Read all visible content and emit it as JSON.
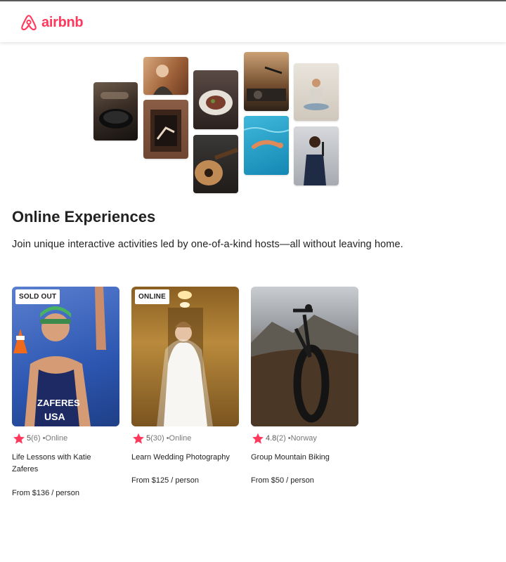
{
  "header": {
    "brand": "airbnb"
  },
  "colors": {
    "brand": "#ff385c"
  },
  "hero": {
    "title": "Online Experiences",
    "subtitle": "Join unique interactive activities led by one-of-a-kind hosts—all without leaving home."
  },
  "experiences": [
    {
      "badge": "SOLD OUT",
      "rating": "5",
      "reviews": "(6)",
      "location": "•Online",
      "title": "Life Lessons with Katie Zaferes",
      "price": "From $136 / person"
    },
    {
      "badge": "ONLINE",
      "rating": "5",
      "reviews": "(30)",
      "location": "•Online",
      "title": "Learn Wedding Photography",
      "price": "From $125 / person"
    },
    {
      "badge": "",
      "rating": "4.8",
      "reviews": "(2)",
      "location": "•Norway",
      "title": "Group Mountain Biking",
      "price": "From $50 / person"
    }
  ]
}
